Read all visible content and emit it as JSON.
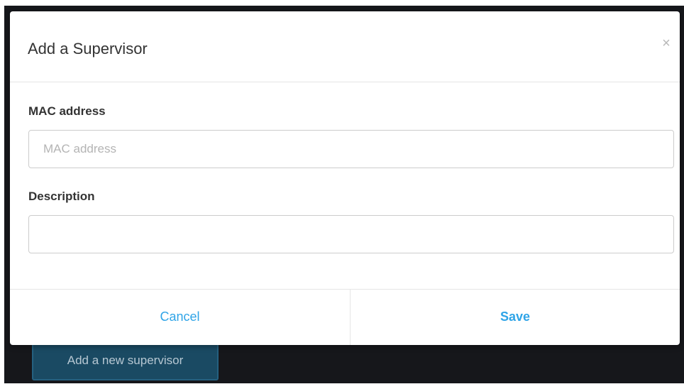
{
  "modal": {
    "title": "Add a Supervisor",
    "close_glyph": "×",
    "fields": [
      {
        "label": "MAC address",
        "placeholder": "MAC address",
        "value": ""
      },
      {
        "label": "Description",
        "placeholder": "",
        "value": ""
      }
    ],
    "cancel_label": "Cancel",
    "save_label": "Save"
  },
  "background": {
    "add_button_label": "Add a new supervisor"
  },
  "colors": {
    "accent": "#2fa4e7",
    "backdrop": "#16171b",
    "background_button": "#1a4a63"
  },
  "icons": {
    "close": "close-icon"
  }
}
